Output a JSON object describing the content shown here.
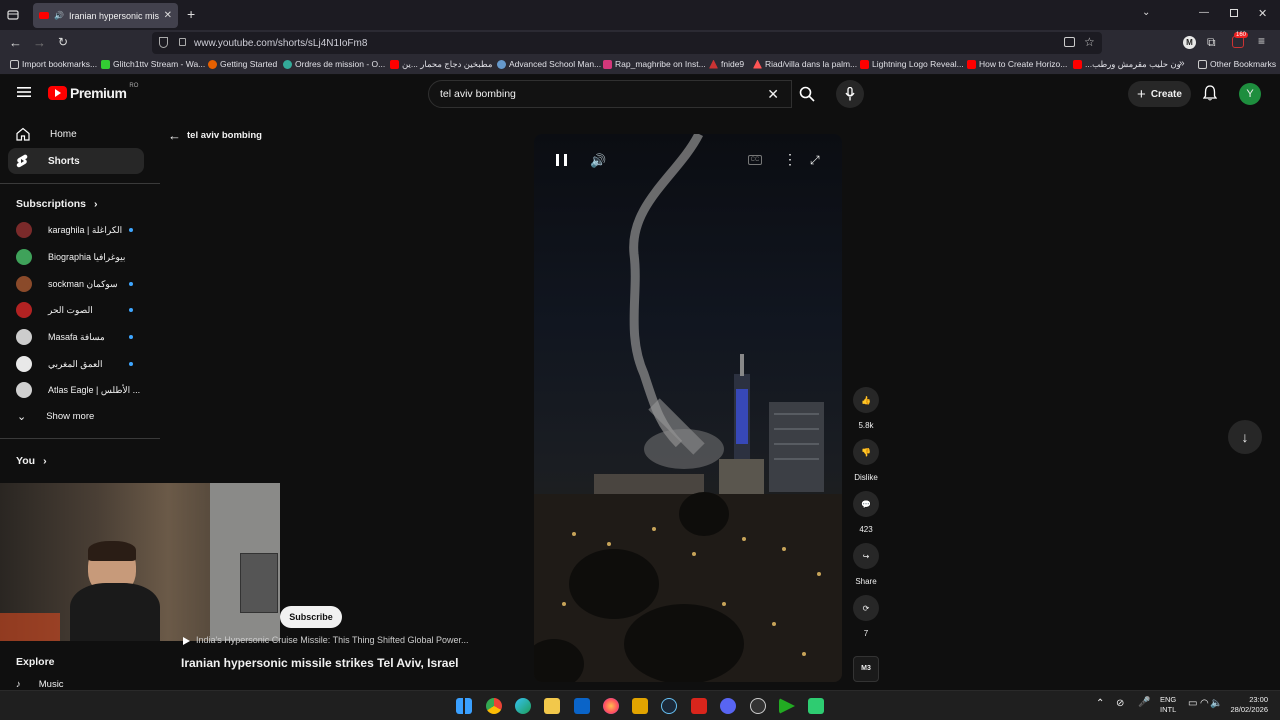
{
  "browser": {
    "tab_title": "Iranian hypersonic missile s",
    "url": "www.youtube.com/shorts/sLj4N1IoFm8",
    "profile_letter": "M",
    "extensions_badge": "160",
    "bookmarks": [
      "Import bookmarks...",
      "Glitch1ttv Stream - Wa...",
      "Getting Started",
      "Ordres de mission - O...",
      "مطبخين دجاج محمار ...ين",
      "Advanced School Man...",
      "Rap_maghribe on Inst...",
      "fnide9",
      "Riad/villa dans la palm...",
      "Lightning Logo Reveal...",
      "How to Create Horizo...",
      "...ون حليب مقرمش ورطب"
    ],
    "other_bookmarks": "Other Bookmarks"
  },
  "youtube": {
    "logo_text": "Premium",
    "region": "RO",
    "search_query": "tel aviv bombing",
    "create_label": "Create",
    "avatar_letter": "Y",
    "sidebar": {
      "home": "Home",
      "shorts": "Shorts",
      "subscriptions_title": "Subscriptions",
      "subscriptions": [
        {
          "name": "karaghila | الكراغلة",
          "color": "#7a2a2a",
          "dot": true
        },
        {
          "name": "Biographia بيوغرافيا",
          "color": "#3fa25a",
          "dot": false
        },
        {
          "name": "sockman سوكمان",
          "color": "#8a4a2a",
          "dot": true
        },
        {
          "name": "الصوت الحر",
          "color": "#b22222",
          "dot": true
        },
        {
          "name": "Masafa مسافة",
          "color": "#cccccc",
          "dot": true
        },
        {
          "name": "العمق المغربي",
          "color": "#e8e8e8",
          "dot": true
        },
        {
          "name": "Atlas Eagle | الأطلس ...",
          "color": "#d0d0d0",
          "dot": false
        }
      ],
      "show_more": "Show more",
      "you_title": "You",
      "explore_title": "Explore",
      "music": "Music"
    },
    "back_label": "tel aviv bombing",
    "short": {
      "title": "Iranian hypersonic missile strikes Tel Aviv, Israel",
      "related": "India's Hypersonic Cruise Missile: This Thing Shifted Global Power...",
      "subscribe": "Subscribe",
      "likes": "5.8k",
      "dislike": "Dislike",
      "comments": "423",
      "share": "Share",
      "remix": "7",
      "channel_badge": "M3"
    }
  },
  "taskbar": {
    "lang": "ENG",
    "layout": "INTL",
    "time": "23:00",
    "date": "28/02/2026"
  }
}
